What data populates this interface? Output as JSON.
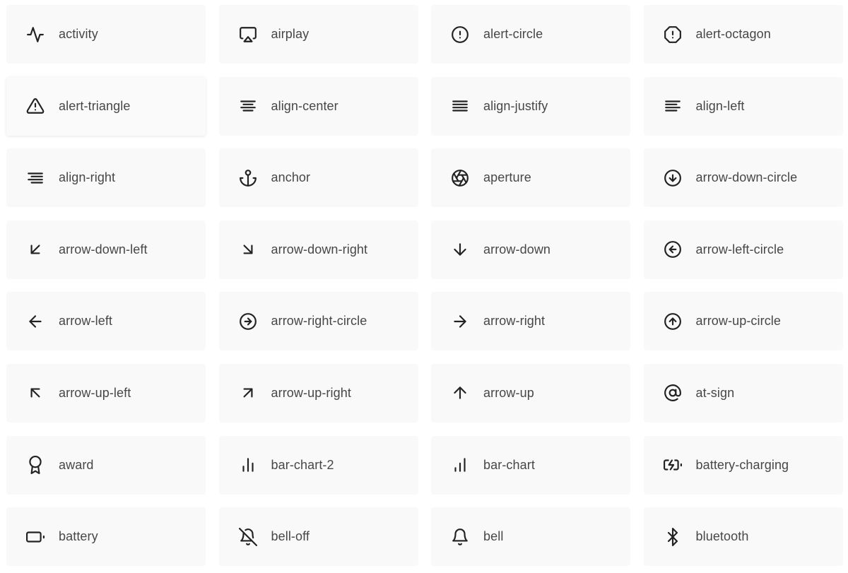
{
  "icons": [
    {
      "name": "activity",
      "icon": "activity-icon"
    },
    {
      "name": "airplay",
      "icon": "airplay-icon"
    },
    {
      "name": "alert-circle",
      "icon": "alert-circle-icon"
    },
    {
      "name": "alert-octagon",
      "icon": "alert-octagon-icon"
    },
    {
      "name": "alert-triangle",
      "icon": "alert-triangle-icon",
      "hovered": true
    },
    {
      "name": "align-center",
      "icon": "align-center-icon"
    },
    {
      "name": "align-justify",
      "icon": "align-justify-icon"
    },
    {
      "name": "align-left",
      "icon": "align-left-icon"
    },
    {
      "name": "align-right",
      "icon": "align-right-icon"
    },
    {
      "name": "anchor",
      "icon": "anchor-icon"
    },
    {
      "name": "aperture",
      "icon": "aperture-icon"
    },
    {
      "name": "arrow-down-circle",
      "icon": "arrow-down-circle-icon"
    },
    {
      "name": "arrow-down-left",
      "icon": "arrow-down-left-icon"
    },
    {
      "name": "arrow-down-right",
      "icon": "arrow-down-right-icon"
    },
    {
      "name": "arrow-down",
      "icon": "arrow-down-icon"
    },
    {
      "name": "arrow-left-circle",
      "icon": "arrow-left-circle-icon"
    },
    {
      "name": "arrow-left",
      "icon": "arrow-left-icon"
    },
    {
      "name": "arrow-right-circle",
      "icon": "arrow-right-circle-icon"
    },
    {
      "name": "arrow-right",
      "icon": "arrow-right-icon"
    },
    {
      "name": "arrow-up-circle",
      "icon": "arrow-up-circle-icon"
    },
    {
      "name": "arrow-up-left",
      "icon": "arrow-up-left-icon"
    },
    {
      "name": "arrow-up-right",
      "icon": "arrow-up-right-icon"
    },
    {
      "name": "arrow-up",
      "icon": "arrow-up-icon"
    },
    {
      "name": "at-sign",
      "icon": "at-sign-icon"
    },
    {
      "name": "award",
      "icon": "award-icon"
    },
    {
      "name": "bar-chart-2",
      "icon": "bar-chart-2-icon"
    },
    {
      "name": "bar-chart",
      "icon": "bar-chart-icon"
    },
    {
      "name": "battery-charging",
      "icon": "battery-charging-icon"
    },
    {
      "name": "battery",
      "icon": "battery-icon"
    },
    {
      "name": "bell-off",
      "icon": "bell-off-icon"
    },
    {
      "name": "bell",
      "icon": "bell-icon"
    },
    {
      "name": "bluetooth",
      "icon": "bluetooth-icon"
    }
  ],
  "colors": {
    "card_background": "#f9f9f9",
    "icon": "#222222",
    "label": "#474747",
    "page_background": "#ffffff"
  }
}
